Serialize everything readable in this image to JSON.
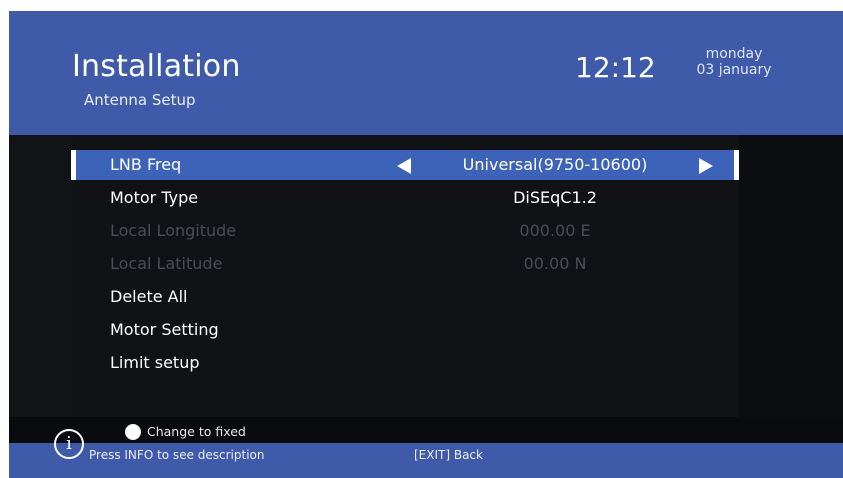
{
  "header": {
    "title": "Installation",
    "subtitle": "Antenna Setup",
    "time": "12:12",
    "day": "monday",
    "date": "03 january"
  },
  "menu": {
    "items": [
      {
        "label": "LNB Freq",
        "value": "Universal(9750-10600)",
        "state": "selected"
      },
      {
        "label": "Motor Type",
        "value": "DiSEqC1.2",
        "state": "enabled"
      },
      {
        "label": "Local Longitude",
        "value": "000.00 E",
        "state": "disabled"
      },
      {
        "label": "Local Latitude",
        "value": "00.00 N",
        "state": "disabled"
      },
      {
        "label": "Delete All",
        "value": "",
        "state": "enabled"
      },
      {
        "label": "Motor Setting",
        "value": "",
        "state": "enabled"
      },
      {
        "label": "Limit setup",
        "value": "",
        "state": "enabled"
      }
    ]
  },
  "hint": {
    "white_button_label": "Change to fixed"
  },
  "statusbar": {
    "info_text": "Press INFO to see description",
    "exit_text": "[EXIT] Back"
  },
  "colors": {
    "header_bg": "#3f5aa8",
    "selected_row": "#3d63b9",
    "panel_bg": "#101216",
    "disabled_text": "#4a4d55"
  },
  "icons": [
    "arrow-left-icon",
    "arrow-right-icon",
    "white-button-icon",
    "info-icon"
  ]
}
